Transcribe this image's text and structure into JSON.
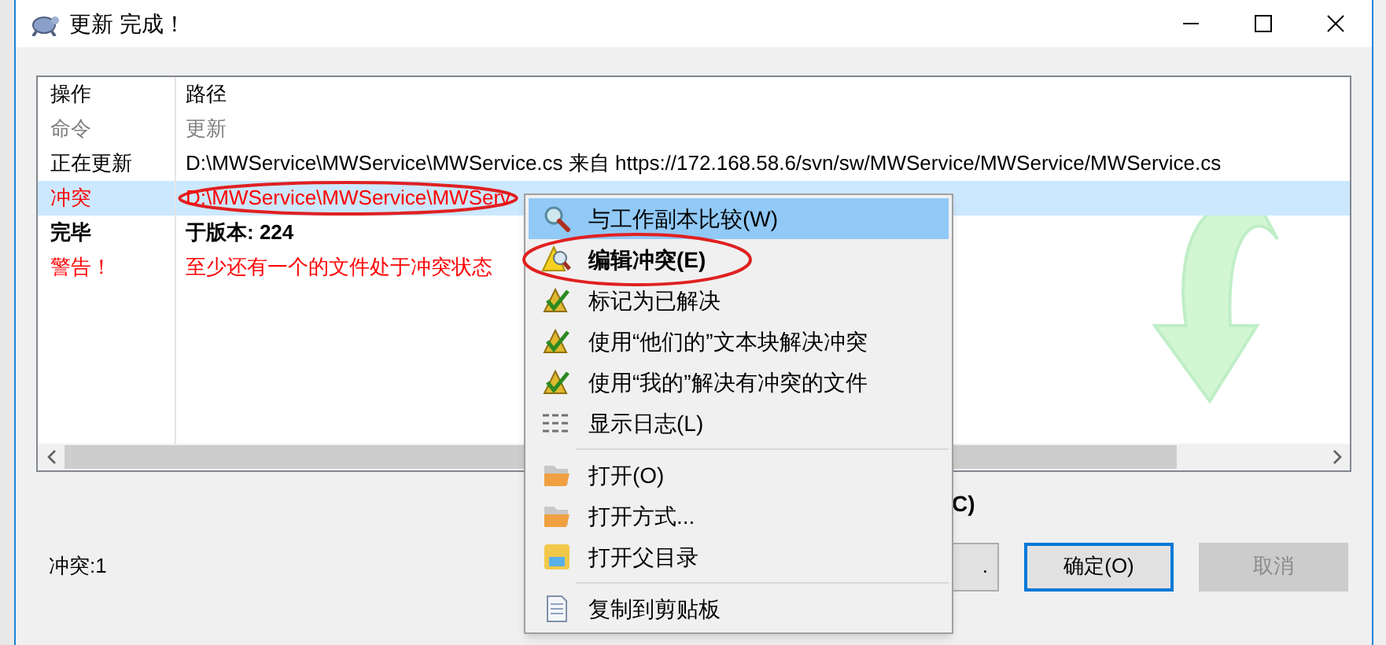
{
  "window": {
    "title": "更新 完成！"
  },
  "table": {
    "columns": [
      "操作",
      "路径"
    ],
    "rows": [
      {
        "kind": "command",
        "selected": false,
        "action": "命令",
        "path": "更新"
      },
      {
        "kind": "normal",
        "selected": false,
        "action": "正在更新",
        "path": "D:\\MWService\\MWService\\MWService.cs 来自 https://172.168.58.6/svn/sw/MWService/MWService/MWService.cs"
      },
      {
        "kind": "conflict",
        "selected": true,
        "action": "冲突",
        "path": "D:\\MWService\\MWService\\MWServ"
      },
      {
        "kind": "done",
        "selected": false,
        "action": "完毕",
        "path": "于版本: 224"
      },
      {
        "kind": "warning",
        "selected": false,
        "action": "警告！",
        "path": "至少还有一个的文件处于冲突状态"
      }
    ]
  },
  "hidden_label_fragment": "C)",
  "status": "冲突:1",
  "buttons": [
    {
      "label": ".",
      "disabled": false,
      "focused": false
    },
    {
      "label": "确定(O)",
      "disabled": false,
      "focused": true
    },
    {
      "label": "取消",
      "disabled": true,
      "focused": false
    }
  ],
  "context_menu": {
    "items": [
      {
        "kind": "compare",
        "label": "与工作副本比较(W)",
        "selected": true,
        "default": false
      },
      {
        "kind": "edit-conflict",
        "label": "编辑冲突(E)",
        "selected": false,
        "default": true
      },
      {
        "kind": "resolve",
        "label": "标记为已解决",
        "selected": false,
        "default": false
      },
      {
        "kind": "resolve",
        "label": "使用“他们的”文本块解决冲突",
        "selected": false,
        "default": false
      },
      {
        "kind": "resolve",
        "label": "使用“我的”解决有冲突的文件",
        "selected": false,
        "default": false
      },
      {
        "kind": "log",
        "label": "显示日志(L)",
        "selected": false,
        "default": false
      },
      {
        "kind": "separator"
      },
      {
        "kind": "open",
        "label": "打开(O)",
        "selected": false,
        "default": false
      },
      {
        "kind": "open",
        "label": "打开方式...",
        "selected": false,
        "default": false
      },
      {
        "kind": "folder",
        "label": "打开父目录",
        "selected": false,
        "default": false
      },
      {
        "kind": "separator"
      },
      {
        "kind": "copy",
        "label": "复制到剪贴板",
        "selected": false,
        "default": false
      }
    ]
  }
}
